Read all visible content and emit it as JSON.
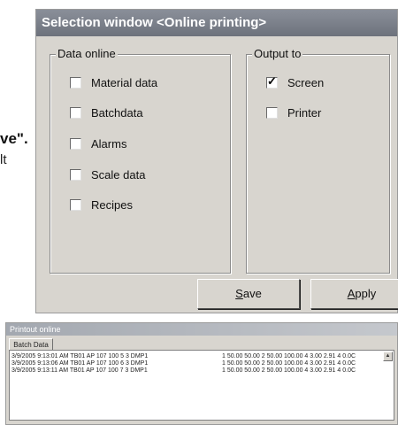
{
  "doc": {
    "bold_fragment": "ve\".",
    "line_fragment": "lt"
  },
  "selection_window": {
    "title": "Selection window <Online printing>",
    "data_online": {
      "legend": "Data online",
      "items": [
        {
          "label": "Material data",
          "checked": false
        },
        {
          "label": "Batchdata",
          "checked": false
        },
        {
          "label": "Alarms",
          "checked": false
        },
        {
          "label": "Scale data",
          "checked": false
        },
        {
          "label": "Recipes",
          "checked": false
        }
      ]
    },
    "output_to": {
      "legend": "Output to",
      "items": [
        {
          "label": "Screen",
          "checked": true
        },
        {
          "label": "Printer",
          "checked": false
        }
      ]
    },
    "buttons": {
      "save": {
        "accel": "S",
        "rest": "ave"
      },
      "apply": {
        "accel": "A",
        "rest": "pply"
      }
    }
  },
  "printout_window": {
    "title": "Printout online",
    "tab": "Batch Data",
    "rows": [
      {
        "left": "3/9/2005 9:13:01 AM TB01 AP  107 100 5 3 DMP1",
        "right": "1 50.00 50.00 2 50.00 100.00 4 3.00 2.91 4 0.0C"
      },
      {
        "left": "3/9/2005 9:13:06 AM TB01 AP  107 100 6 3 DMP1",
        "right": "1 50.00 50.00 2 50.00 100.00 4 3.00 2.91 4 0.0C"
      },
      {
        "left": "3/9/2005 9:13:11 AM TB01 AP  107 100 7 3 DMP1",
        "right": "1 50.00 50.00 2 50.00 100.00 4 3.00 2.91 4 0.0C"
      }
    ],
    "scroll_icon": "scroll-up-arrow"
  }
}
